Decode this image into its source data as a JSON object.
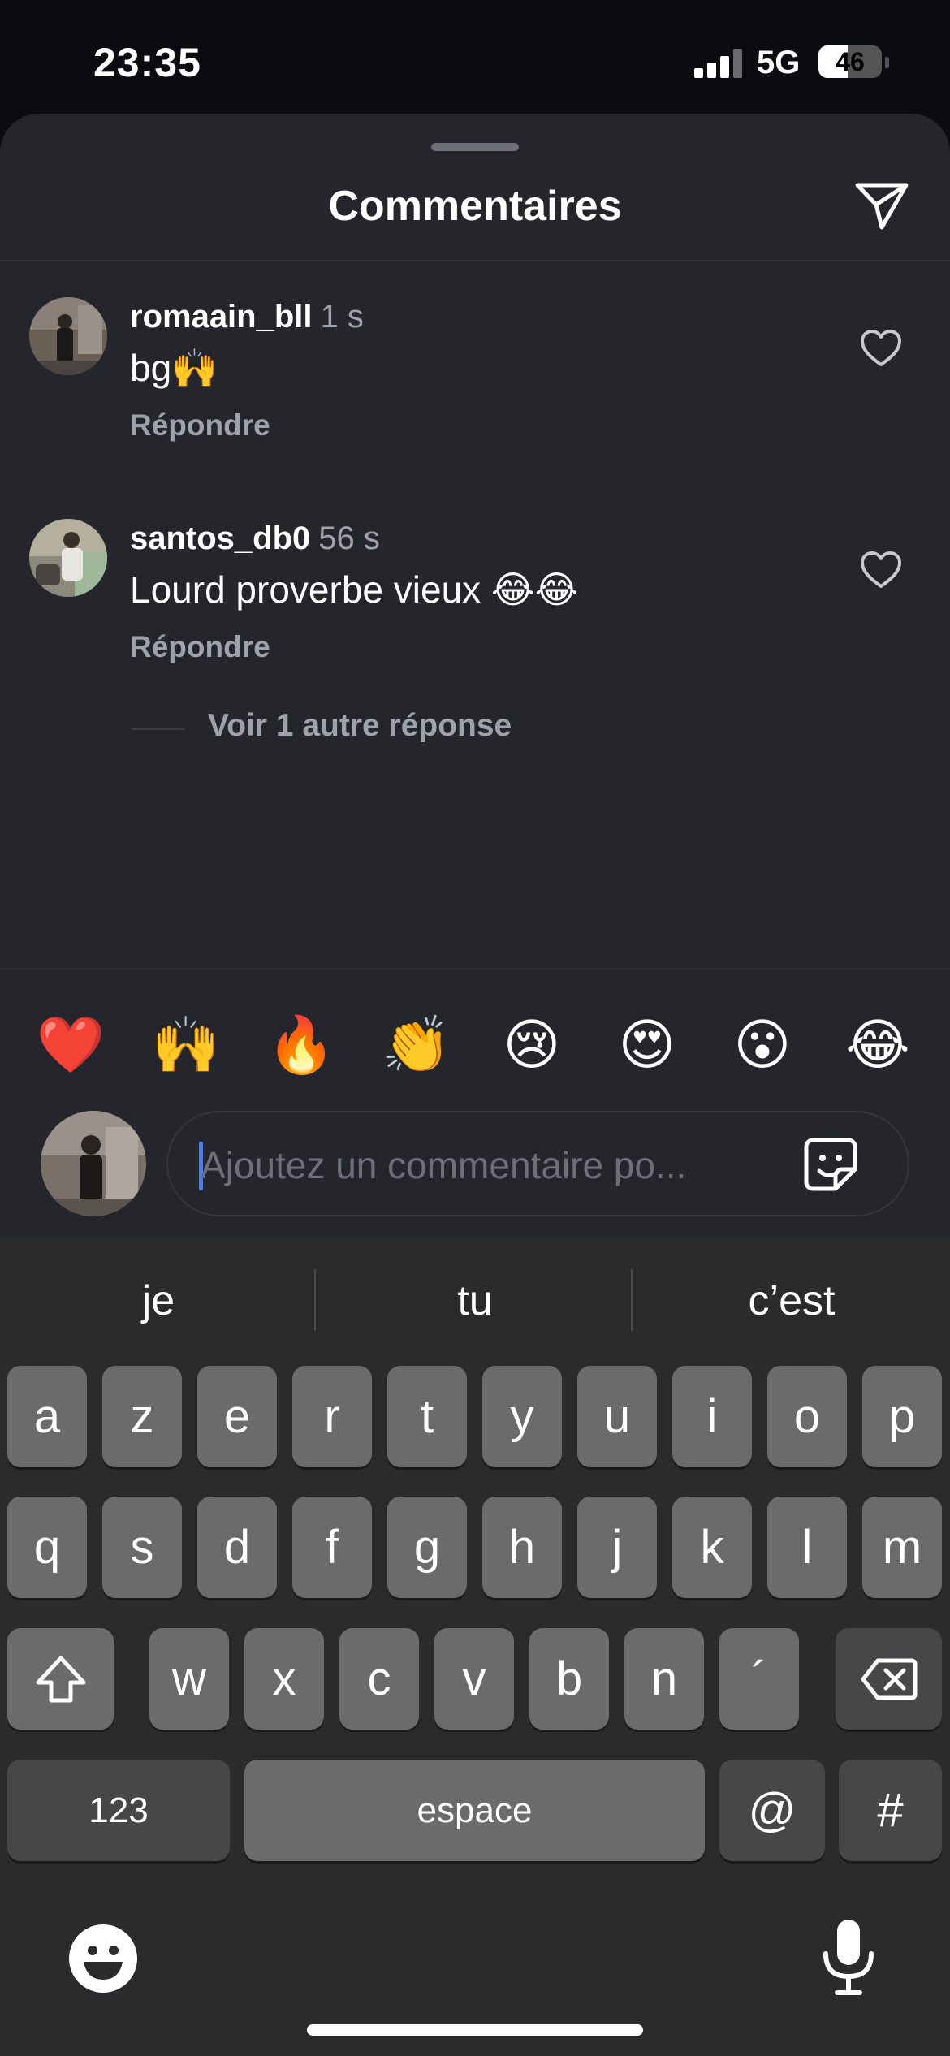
{
  "status": {
    "time": "23:35",
    "network": "5G",
    "battery": "46",
    "battery_level": 0.46
  },
  "sheet": {
    "title": "Commentaires"
  },
  "comments": [
    {
      "username": "romaain_bll",
      "time": "1 s",
      "text": "bg🙌",
      "reply": "Répondre"
    },
    {
      "username": "santos_db0",
      "time": "56 s",
      "text": "Lourd proverbe vieux 😂😂",
      "reply": "Répondre"
    }
  ],
  "more_replies": "Voir 1 autre réponse",
  "quick_emojis": [
    "❤️",
    "🙌",
    "🔥",
    "👏",
    "😢",
    "😍",
    "😮",
    "😂"
  ],
  "composer": {
    "placeholder": "Ajoutez un commentaire po..."
  },
  "keyboard": {
    "suggestions": [
      "je",
      "tu",
      "c’est"
    ],
    "row1": [
      "a",
      "z",
      "e",
      "r",
      "t",
      "y",
      "u",
      "i",
      "o",
      "p"
    ],
    "row2": [
      "q",
      "s",
      "d",
      "f",
      "g",
      "h",
      "j",
      "k",
      "l",
      "m"
    ],
    "row3": [
      "w",
      "x",
      "c",
      "v",
      "b",
      "n",
      "´"
    ],
    "numbers": "123",
    "space": "espace",
    "at": "@",
    "hash": "#"
  },
  "icons": {
    "send": "send-icon",
    "heart": "heart-outline-icon",
    "sticker": "sticker-icon",
    "shift": "shift-icon",
    "backspace": "backspace-icon",
    "emoji": "emoji-icon",
    "mic": "microphone-icon"
  },
  "colors": {
    "accent_caret": "#4a7cff",
    "sheet_bg": "#24262b",
    "muted_text": "#9ea2ab"
  }
}
